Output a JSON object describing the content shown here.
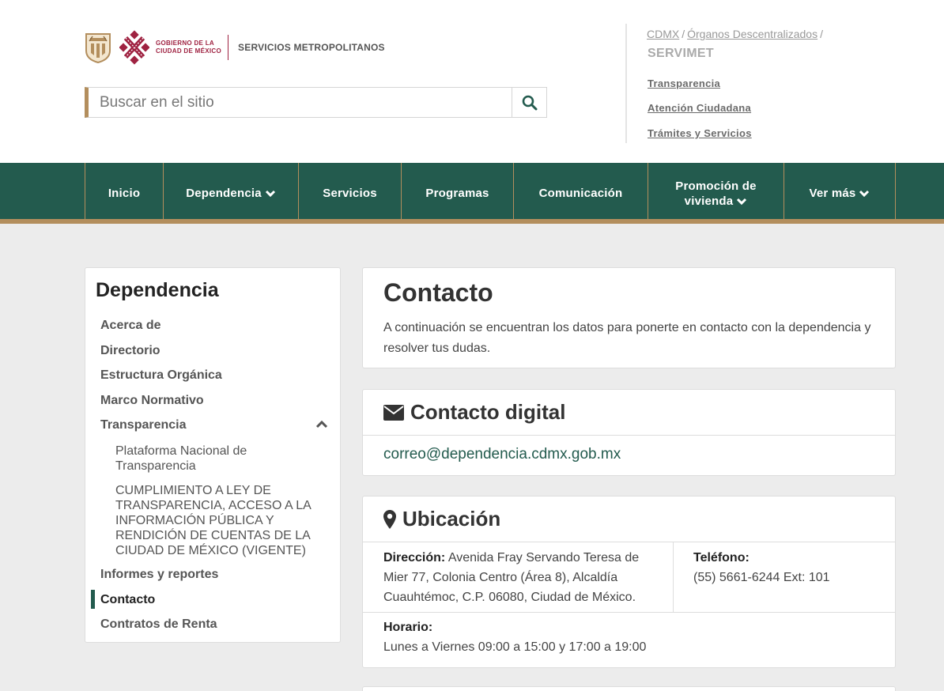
{
  "header": {
    "gov_line1": "GOBIERNO DE LA",
    "gov_line2": "CIUDAD DE MÉXICO",
    "org_name": "SERVICIOS METROPOLITANOS",
    "search_placeholder": "Buscar en el sitio",
    "breadcrumb": [
      "CDMX",
      "Órganos Descentralizados"
    ],
    "breadcrumb_sep": "/",
    "site_name": "SERVIMET",
    "quick_links": [
      "Transparencia",
      "Atención Ciudadana",
      "Trámites y Servicios"
    ]
  },
  "nav": {
    "items": [
      {
        "label": "Inicio"
      },
      {
        "label": "Dependencia"
      },
      {
        "label": "Servicios"
      },
      {
        "label": "Programas"
      },
      {
        "label": "Comunicación"
      },
      {
        "label_line1": "Promoción de",
        "label_line2": "vivienda"
      },
      {
        "label": "Ver más"
      }
    ]
  },
  "sidebar": {
    "title": "Dependencia",
    "items": [
      "Acerca de",
      "Directorio",
      "Estructura Orgánica",
      "Marco Normativo",
      "Transparencia",
      "Informes y reportes",
      "Contacto",
      "Contratos de Renta"
    ],
    "sub_items": [
      "Plataforma Nacional de Transparencia",
      "CUMPLIMIENTO A LEY DE TRANSPARENCIA, ACCESO A LA INFORMACIÓN PÚBLICA Y RENDICIÓN DE CUENTAS DE LA CIUDAD DE MÉXICO (VIGENTE)"
    ]
  },
  "main": {
    "title": "Contacto",
    "description": "A continuación se encuentran los datos para ponerte en contacto con la dependencia y resolver tus dudas.",
    "digital": {
      "title": "Contacto digital",
      "email": "correo@dependencia.cdmx.gob.mx"
    },
    "location": {
      "title": "Ubicación",
      "address_label": "Dirección:",
      "address": "Avenida Fray Servando Teresa de Mier 77, Colonia Centro (Área 8), Alcaldía Cuauhtémoc, C.P. 06080, Ciudad de México.",
      "phone_label": "Teléfono:",
      "phone": "(55) 5661-6244 Ext: 101",
      "hours_label": "Horario:",
      "hours": "Lunes a Viernes 09:00 a 15:00 y 17:00 a 19:00"
    }
  },
  "colors": {
    "primary_green": "#235b4e",
    "gold": "#b38e5d",
    "wine": "#9f2241"
  },
  "icons": [
    "shield-icon",
    "cdmx-logo-icon",
    "search-icon",
    "chevron-down-icon",
    "chevron-up-icon",
    "envelope-icon",
    "map-marker-icon"
  ]
}
